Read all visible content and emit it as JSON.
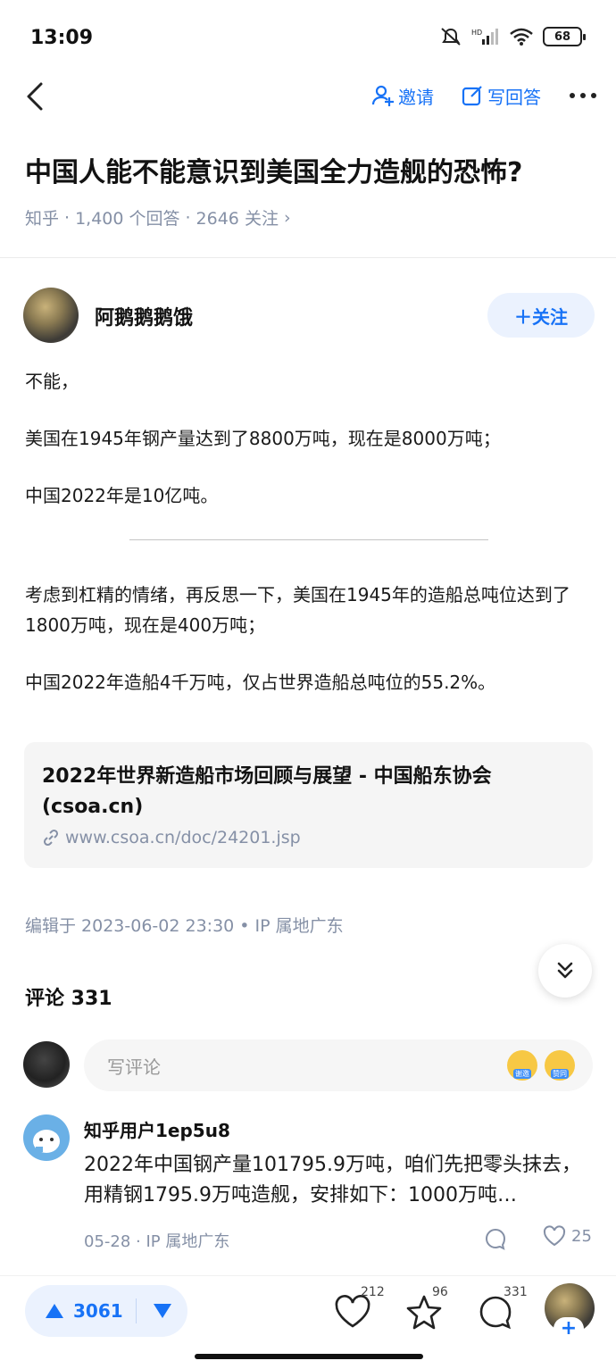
{
  "status": {
    "time": "13:09",
    "battery": "68"
  },
  "topbar": {
    "invite_label": "邀请",
    "write_answer_label": "写回答"
  },
  "question": {
    "title": "中国人能不能意识到美国全力造舰的恐怖?",
    "source": "知乎",
    "answers": "1,400 个回答",
    "followers": "2646 关注",
    "sep": "·",
    "chevron": "›"
  },
  "author": {
    "name": "阿鹅鹅鹅饿",
    "follow_label": "＋关注"
  },
  "content": {
    "p1": "不能，",
    "p2": "美国在1945年钢产量达到了8800万吨，现在是8000万吨；",
    "p3": "中国2022年是10亿吨。",
    "p4": "考虑到杠精的情绪，再反思一下，美国在1945年的造船总吨位达到了1800万吨，现在是400万吨；",
    "p5": "中国2022年造船4千万吨，仅占世界造船总吨位的55.2%。"
  },
  "link_card": {
    "title": "2022年世界新造船市场回顾与展望 - 中国船东协会 (csoa.cn)",
    "url": "www.csoa.cn/doc/24201.jsp"
  },
  "edit_meta": "编辑于 2023-06-02 23:30 • IP 属地广东",
  "comments": {
    "header": "评论 331",
    "input_placeholder": "写评论",
    "emoji_a_tag": "谢邀",
    "emoji_b_tag": "赞同",
    "items": [
      {
        "user": "知乎用户1ep5u8",
        "text": "2022年中国钢产量101795.9万吨，咱们先把零头抹去，用精钢1795.9万吨造舰，安排如下：1000万吨…",
        "meta": "05-28 · IP 属地广东",
        "likes": "25"
      }
    ]
  },
  "bottom": {
    "upvotes": "3061",
    "likes": "212",
    "favorites": "96",
    "comments": "331",
    "plus": "+"
  },
  "colors": {
    "accent": "#1772f6",
    "meta_gray": "#8590a6",
    "vote_bg": "#ebf2fe"
  },
  "icons": [
    "back-arrow-icon",
    "invite-person-icon",
    "write-answer-icon",
    "more-dots-icon",
    "link-icon",
    "double-chevron-down-icon",
    "reply-bubble-icon",
    "heart-icon",
    "star-icon",
    "comment-icon",
    "triangle-up-icon",
    "triangle-down-icon"
  ]
}
